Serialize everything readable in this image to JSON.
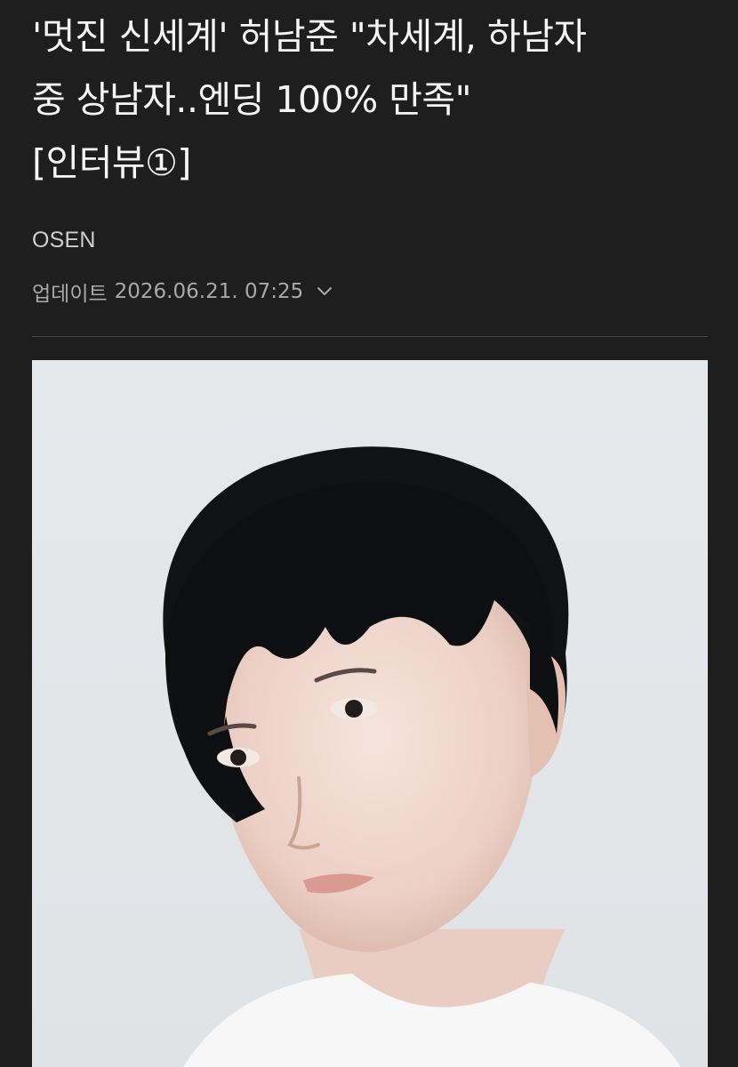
{
  "article": {
    "headline_lines": [
      "'멋진 신세계' 허남준 \"차세계, 하남자",
      "중 상남자..엔딩 100% 만족\"",
      "[인터뷰①]"
    ],
    "press": "OSEN",
    "update_label": "업데이트",
    "update_datetime": "2026.06.21. 07:25",
    "expand_icon": "chevron-down-icon"
  },
  "photo": {
    "subject": "portrait-photo"
  },
  "colors": {
    "background": "#1e1e1e",
    "headline": "#f5f5f5",
    "meta": "#a9a9a9",
    "divider": "#4a4a4a",
    "photo_backdrop": "#e4e7ea"
  }
}
